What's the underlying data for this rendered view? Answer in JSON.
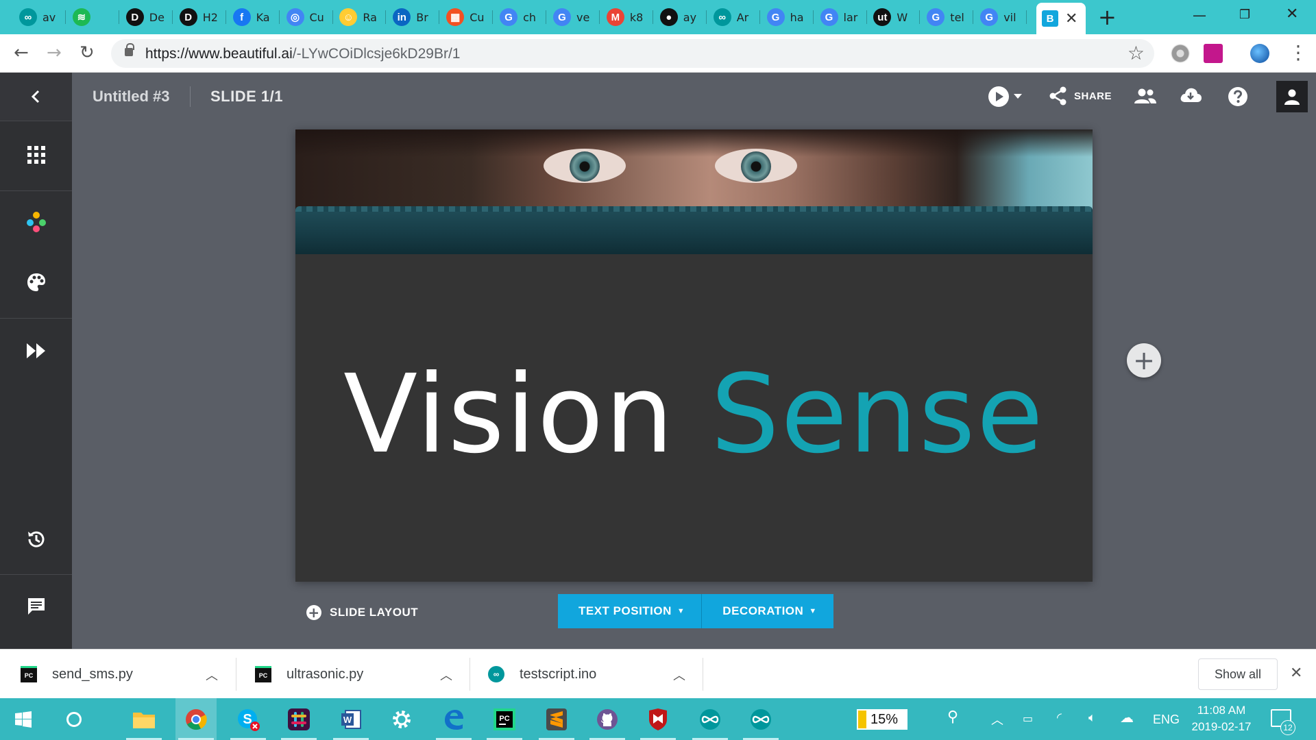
{
  "browser": {
    "tabs": [
      {
        "title": "av",
        "icon": "arduino-icon",
        "color": "#00979c"
      },
      {
        "title": "",
        "icon": "spotify-icon",
        "color": "#1db954"
      },
      {
        "title": "De",
        "icon": "dev-icon",
        "color": "#111111"
      },
      {
        "title": "H2",
        "icon": "dev-icon",
        "color": "#111111"
      },
      {
        "title": "Ka",
        "icon": "facebook-icon",
        "color": "#1877f2"
      },
      {
        "title": "Cu",
        "icon": "google-calendar-icon",
        "color": "#4285f4"
      },
      {
        "title": "Ra",
        "icon": "emoji-icon",
        "color": "#ffcc33"
      },
      {
        "title": "Br",
        "icon": "linkedin-icon",
        "color": "#0a66c2"
      },
      {
        "title": "Cu",
        "icon": "microsoft-icon",
        "color": "#f25022"
      },
      {
        "title": "ch",
        "icon": "google-icon",
        "color": "#4285f4"
      },
      {
        "title": "ve",
        "icon": "google-icon",
        "color": "#4285f4"
      },
      {
        "title": "k8",
        "icon": "gmail-icon",
        "color": "#ea4335"
      },
      {
        "title": "ay",
        "icon": "github-icon",
        "color": "#111111"
      },
      {
        "title": "Ar",
        "icon": "arduino-icon",
        "color": "#00979c"
      },
      {
        "title": "ha",
        "icon": "google-icon",
        "color": "#4285f4"
      },
      {
        "title": "lar",
        "icon": "google-icon",
        "color": "#4285f4"
      },
      {
        "title": "W",
        "icon": "news-icon",
        "color": "#111111"
      },
      {
        "title": "tel",
        "icon": "google-icon",
        "color": "#4285f4"
      },
      {
        "title": "vil",
        "icon": "google-icon",
        "color": "#4285f4"
      }
    ],
    "active_tab": {
      "favicon_letter": "B",
      "color": "#11a6dd"
    },
    "url_host": "https://www.beautiful.ai",
    "url_path": "/-LYwCOiDlcsje6kD29Br/1"
  },
  "app": {
    "doc_title": "Untitled #3",
    "slide_count": "SLIDE 1/1",
    "share_label": "SHARE",
    "slide": {
      "title_word1": "Vision",
      "title_word2": "Sense",
      "accent_color": "#14a3b3"
    },
    "slide_layout_label": "SLIDE LAYOUT",
    "text_position_label": "TEXT POSITION",
    "decoration_label": "DECORATION"
  },
  "downloads": {
    "items": [
      {
        "name": "send_sms.py",
        "icon": "pycharm-icon"
      },
      {
        "name": "ultrasonic.py",
        "icon": "pycharm-icon"
      },
      {
        "name": "testscript.ino",
        "icon": "arduino-icon"
      }
    ],
    "show_all_label": "Show all"
  },
  "taskbar": {
    "battery_percent": "15%",
    "language": "ENG",
    "time": "11:08 AM",
    "date": "2019-02-17",
    "notification_count": "12"
  }
}
